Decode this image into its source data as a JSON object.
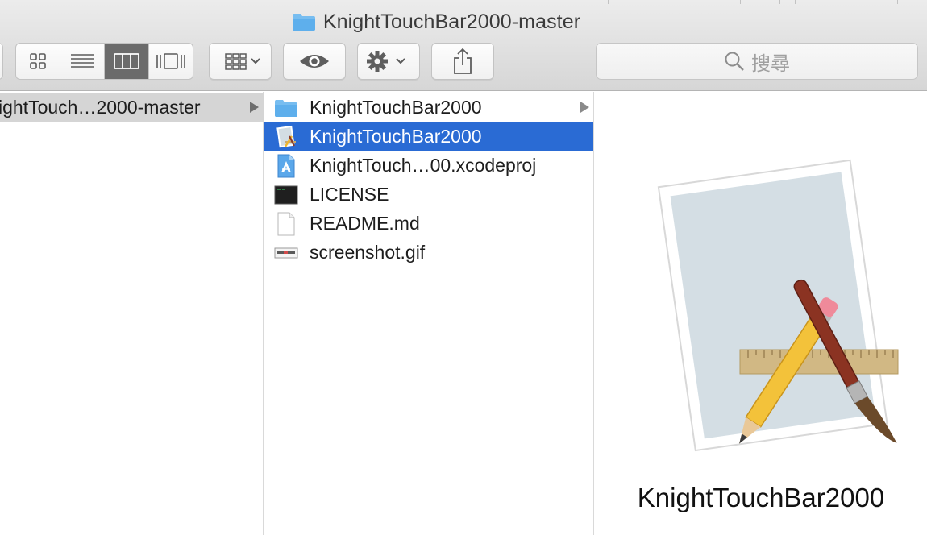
{
  "window": {
    "title": "KnightTouchBar2000-master",
    "title_icon": "folder-icon"
  },
  "toolbar": {
    "view_buttons": [
      {
        "name": "icon-view",
        "icon": "grid-icon",
        "active": false
      },
      {
        "name": "list-view",
        "icon": "list-icon",
        "active": false
      },
      {
        "name": "column-view",
        "icon": "columns-icon",
        "active": true
      },
      {
        "name": "gallery-view",
        "icon": "coverflow-icon",
        "active": false
      }
    ],
    "arrange_icon": "arrange-icon",
    "quicklook_icon": "eye-icon",
    "action_icon": "gear-icon",
    "share_icon": "share-icon",
    "search_placeholder": "搜尋"
  },
  "columns": {
    "parent": {
      "items": [
        {
          "label": "ightTouch…2000-master",
          "selected": true,
          "has_children": true
        }
      ]
    },
    "contents": {
      "items": [
        {
          "label": "KnightTouchBar2000",
          "icon": "folder-icon",
          "has_children": true,
          "selected": false
        },
        {
          "label": "KnightTouchBar2000",
          "icon": "app-icon",
          "has_children": false,
          "selected": true
        },
        {
          "label": "KnightTouch…00.xcodeproj",
          "icon": "xcodeproj-icon",
          "has_children": false,
          "selected": false
        },
        {
          "label": "LICENSE",
          "icon": "terminal-doc-icon",
          "has_children": false,
          "selected": false
        },
        {
          "label": "README.md",
          "icon": "document-icon",
          "has_children": false,
          "selected": false
        },
        {
          "label": "screenshot.gif",
          "icon": "gif-icon",
          "has_children": false,
          "selected": false
        }
      ]
    },
    "preview": {
      "name": "KnightTouchBar2000",
      "icon": "app-preview-icon"
    }
  },
  "colors": {
    "selection_blue": "#2a6bd4",
    "selection_gray": "#d5d5d5",
    "folder_blue": "#6cb6ec"
  }
}
